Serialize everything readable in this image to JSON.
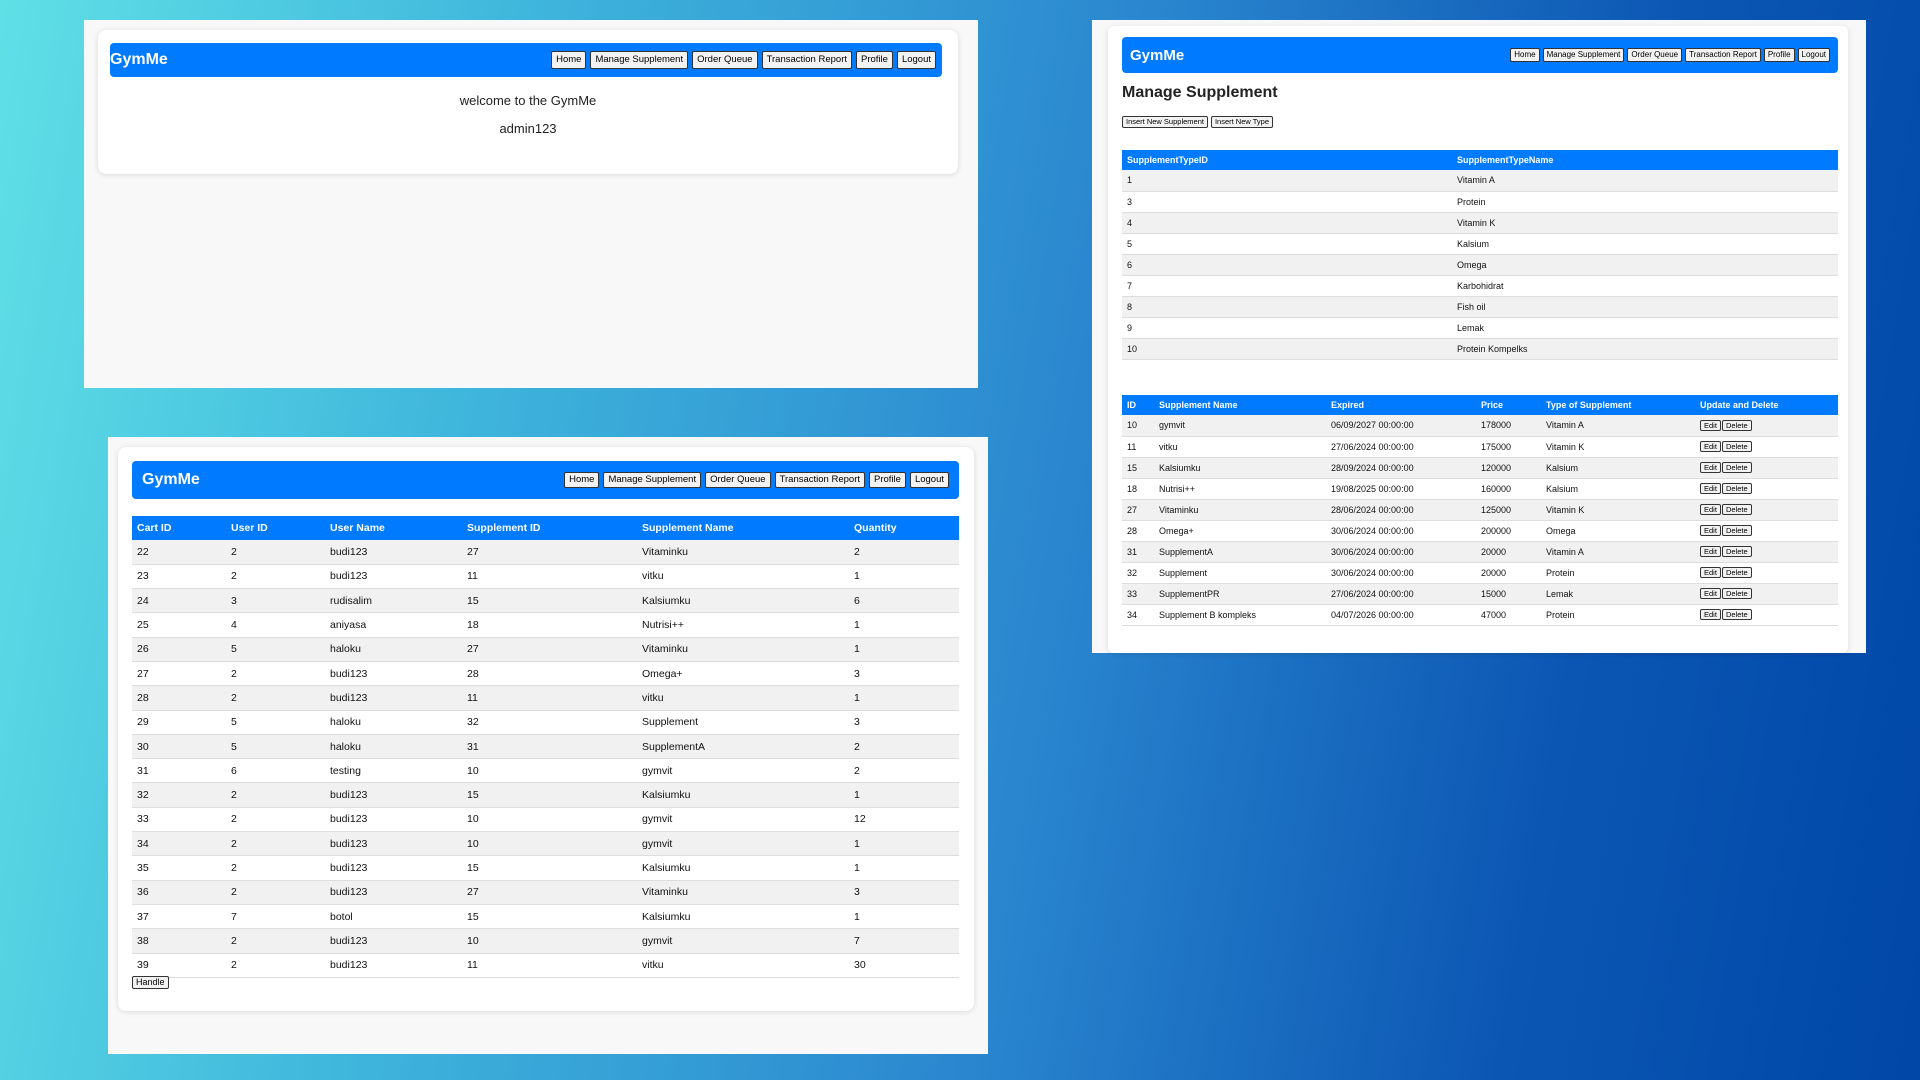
{
  "brand": "GymMe",
  "nav": [
    "Home",
    "Manage Supplement",
    "Order Queue",
    "Transaction Report",
    "Profile",
    "Logout"
  ],
  "home": {
    "welcome": "welcome to the GymMe",
    "username": "admin123"
  },
  "manage": {
    "title": "Manage Supplement",
    "insert_supplement": "Insert New Supplement",
    "insert_type": "Insert New Type",
    "type_headers": [
      "SupplementTypeID",
      "SupplementTypeName"
    ],
    "types": [
      [
        "1",
        "Vitamin A"
      ],
      [
        "3",
        "Protein"
      ],
      [
        "4",
        "Vitamin K"
      ],
      [
        "5",
        "Kalsium"
      ],
      [
        "6",
        "Omega"
      ],
      [
        "7",
        "Karbohidrat"
      ],
      [
        "8",
        "Fish oil"
      ],
      [
        "9",
        "Lemak"
      ],
      [
        "10",
        "Protein Kompelks"
      ]
    ],
    "supp_headers": [
      "ID",
      "Supplement Name",
      "Expired",
      "Price",
      "Type of Supplement",
      "Update and Delete"
    ],
    "edit_label": "Edit",
    "delete_label": "Delete",
    "supplements": [
      [
        "10",
        "gymvit",
        "06/09/2027 00:00:00",
        "178000",
        "Vitamin A"
      ],
      [
        "11",
        "vitku",
        "27/06/2024 00:00:00",
        "175000",
        "Vitamin K"
      ],
      [
        "15",
        "Kalsiumku",
        "28/09/2024 00:00:00",
        "120000",
        "Kalsium"
      ],
      [
        "18",
        "Nutrisi++",
        "19/08/2025 00:00:00",
        "160000",
        "Kalsium"
      ],
      [
        "27",
        "Vitaminku",
        "28/06/2024 00:00:00",
        "125000",
        "Vitamin K"
      ],
      [
        "28",
        "Omega+",
        "30/06/2024 00:00:00",
        "200000",
        "Omega"
      ],
      [
        "31",
        "SupplementA",
        "30/06/2024 00:00:00",
        "20000",
        "Vitamin A"
      ],
      [
        "32",
        "Supplement",
        "30/06/2024 00:00:00",
        "20000",
        "Protein"
      ],
      [
        "33",
        "SupplementPR",
        "27/06/2024 00:00:00",
        "15000",
        "Lemak"
      ],
      [
        "34",
        "Supplement B kompleks",
        "04/07/2026 00:00:00",
        "47000",
        "Protein"
      ]
    ]
  },
  "cart": {
    "headers": [
      "Cart ID",
      "User ID",
      "User Name",
      "Supplement ID",
      "Supplement Name",
      "Quantity"
    ],
    "rows": [
      [
        "22",
        "2",
        "budi123",
        "27",
        "Vitaminku",
        "2"
      ],
      [
        "23",
        "2",
        "budi123",
        "11",
        "vitku",
        "1"
      ],
      [
        "24",
        "3",
        "rudisalim",
        "15",
        "Kalsiumku",
        "6"
      ],
      [
        "25",
        "4",
        "aniyasa",
        "18",
        "Nutrisi++",
        "1"
      ],
      [
        "26",
        "5",
        "haloku",
        "27",
        "Vitaminku",
        "1"
      ],
      [
        "27",
        "2",
        "budi123",
        "28",
        "Omega+",
        "3"
      ],
      [
        "28",
        "2",
        "budi123",
        "11",
        "vitku",
        "1"
      ],
      [
        "29",
        "5",
        "haloku",
        "32",
        "Supplement",
        "3"
      ],
      [
        "30",
        "5",
        "haloku",
        "31",
        "SupplementA",
        "2"
      ],
      [
        "31",
        "6",
        "testing",
        "10",
        "gymvit",
        "2"
      ],
      [
        "32",
        "2",
        "budi123",
        "15",
        "Kalsiumku",
        "1"
      ],
      [
        "33",
        "2",
        "budi123",
        "10",
        "gymvit",
        "12"
      ],
      [
        "34",
        "2",
        "budi123",
        "10",
        "gymvit",
        "1"
      ],
      [
        "35",
        "2",
        "budi123",
        "15",
        "Kalsiumku",
        "1"
      ],
      [
        "36",
        "2",
        "budi123",
        "27",
        "Vitaminku",
        "3"
      ],
      [
        "37",
        "7",
        "botol",
        "15",
        "Kalsiumku",
        "1"
      ],
      [
        "38",
        "2",
        "budi123",
        "10",
        "gymvit",
        "7"
      ],
      [
        "39",
        "2",
        "budi123",
        "11",
        "vitku",
        "30"
      ]
    ],
    "handle_label": "Handle"
  },
  "colors": {
    "primary": "#007bff",
    "row_alt": "#f1f1f1"
  }
}
